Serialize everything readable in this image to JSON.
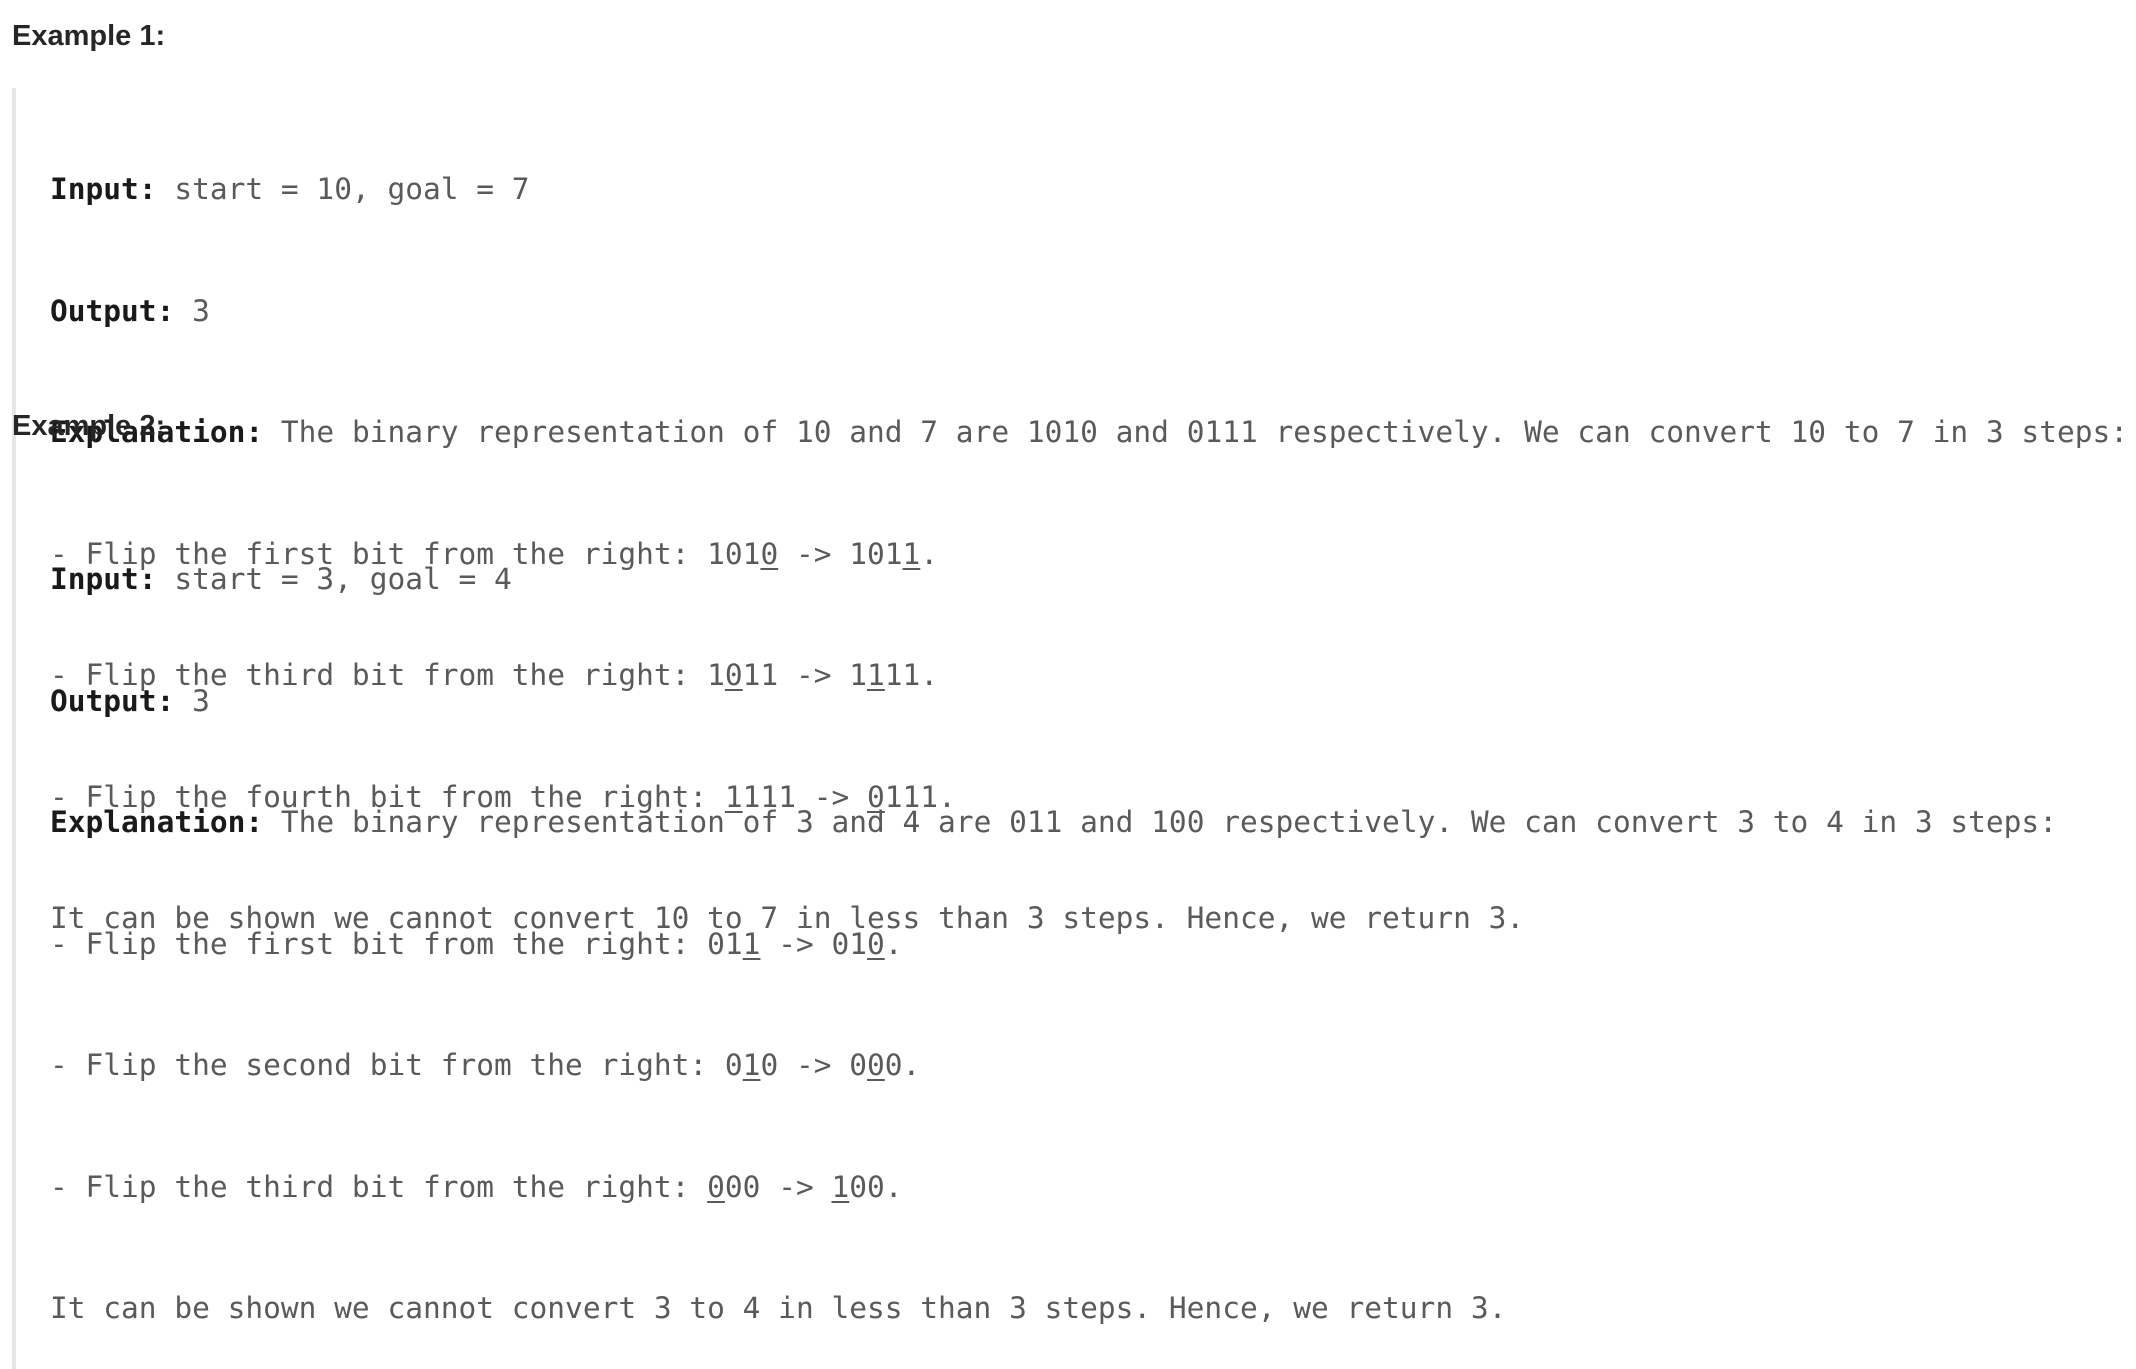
{
  "examples": [
    {
      "heading": "Example 1:",
      "input_label": "Input:",
      "input_value": "start = 10, goal = 7",
      "output_label": "Output:",
      "output_value": "3",
      "explanation_label": "Explanation:",
      "explanation_text": "The binary representation of 10 and 7 are 1010 and 0111 respectively. We can convert 10 to 7 in 3 steps:",
      "steps": [
        {
          "prefix": "- Flip the first bit from the right: ",
          "from": {
            "pre": "101",
            "flip": "0",
            "post": ""
          },
          "arrow": " -> ",
          "to": {
            "pre": "101",
            "flip": "1",
            "post": ""
          },
          "end": "."
        },
        {
          "prefix": "- Flip the third bit from the right: ",
          "from": {
            "pre": "1",
            "flip": "0",
            "post": "11"
          },
          "arrow": " -> ",
          "to": {
            "pre": "1",
            "flip": "1",
            "post": "11"
          },
          "end": "."
        },
        {
          "prefix": "- Flip the fourth bit from the right: ",
          "from": {
            "pre": "",
            "flip": "1",
            "post": "111"
          },
          "arrow": " -> ",
          "to": {
            "pre": "",
            "flip": "0",
            "post": "111"
          },
          "end": "."
        }
      ],
      "conclusion": "It can be shown we cannot convert 10 to 7 in less than 3 steps. Hence, we return 3."
    },
    {
      "heading": "Example 2:",
      "input_label": "Input:",
      "input_value": "start = 3, goal = 4",
      "output_label": "Output:",
      "output_value": "3",
      "explanation_label": "Explanation:",
      "explanation_text": "The binary representation of 3 and 4 are 011 and 100 respectively. We can convert 3 to 4 in 3 steps:",
      "steps": [
        {
          "prefix": "- Flip the first bit from the right: ",
          "from": {
            "pre": "01",
            "flip": "1",
            "post": ""
          },
          "arrow": " -> ",
          "to": {
            "pre": "01",
            "flip": "0",
            "post": ""
          },
          "end": "."
        },
        {
          "prefix": "- Flip the second bit from the right: ",
          "from": {
            "pre": "0",
            "flip": "1",
            "post": "0"
          },
          "arrow": " -> ",
          "to": {
            "pre": "0",
            "flip": "0",
            "post": "0"
          },
          "end": "."
        },
        {
          "prefix": "- Flip the third bit from the right: ",
          "from": {
            "pre": "",
            "flip": "0",
            "post": "00"
          },
          "arrow": " -> ",
          "to": {
            "pre": "",
            "flip": "1",
            "post": "00"
          },
          "end": "."
        }
      ],
      "conclusion": "It can be shown we cannot convert 3 to 4 in less than 3 steps. Hence, we return 3."
    }
  ]
}
